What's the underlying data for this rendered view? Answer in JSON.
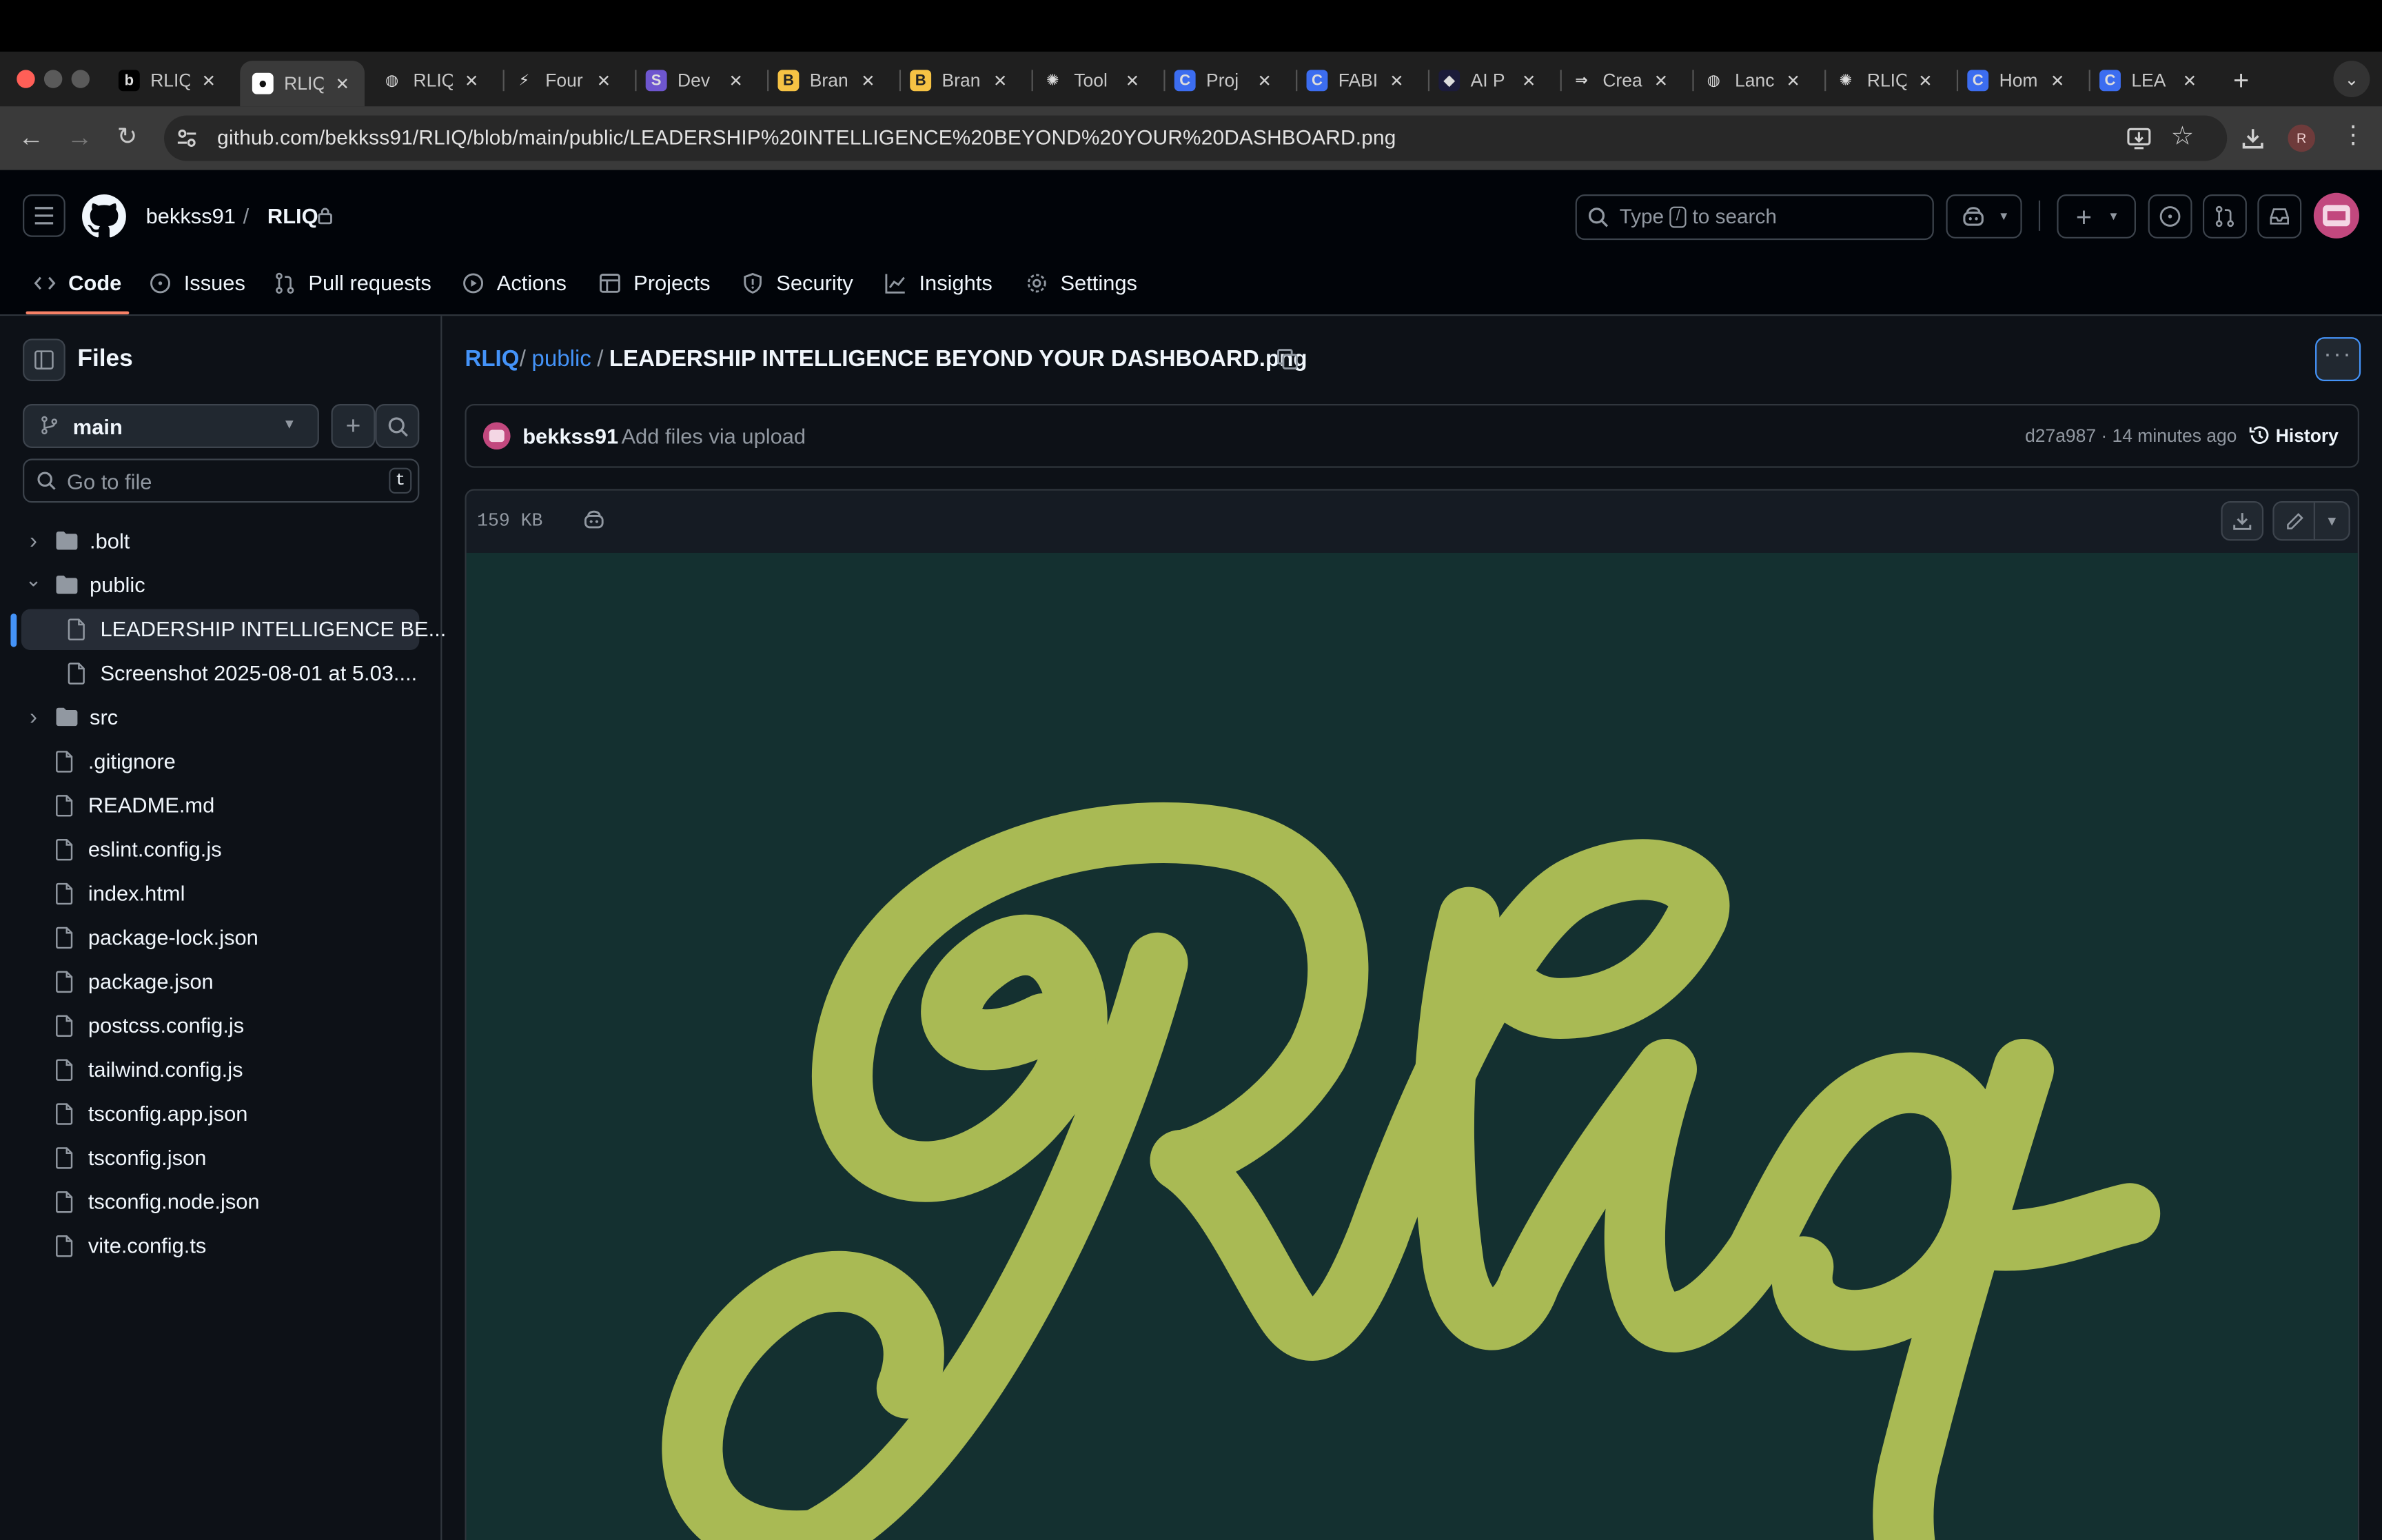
{
  "browser": {
    "tabs": [
      {
        "label": "RLIQ",
        "icon": "bolt-b-icon",
        "active": false
      },
      {
        "label": "RLIQ",
        "icon": "github-icon",
        "active": true
      },
      {
        "label": "RLIQ",
        "icon": "globe-icon",
        "active": false
      },
      {
        "label": "Four",
        "icon": "lightning-icon",
        "active": false
      },
      {
        "label": "Dev",
        "icon": "s-icon",
        "active": false
      },
      {
        "label": "Bran",
        "icon": "b-icon",
        "active": false
      },
      {
        "label": "Bran",
        "icon": "b-icon",
        "active": false
      },
      {
        "label": "Tool",
        "icon": "openai-icon",
        "active": false
      },
      {
        "label": "Proj",
        "icon": "c-icon",
        "active": false
      },
      {
        "label": "FABI",
        "icon": "c-icon",
        "active": false
      },
      {
        "label": "AI P",
        "icon": "ai-icon",
        "active": false
      },
      {
        "label": "Crea",
        "icon": "arrow-icon",
        "active": false
      },
      {
        "label": "Lanc",
        "icon": "globe-icon",
        "active": false
      },
      {
        "label": "RLIQ",
        "icon": "openai-icon",
        "active": false
      },
      {
        "label": "Hom",
        "icon": "c-icon",
        "active": false
      },
      {
        "label": "LEA",
        "icon": "c-icon",
        "active": false
      }
    ],
    "url": "github.com/bekkss91/RLIQ/blob/main/public/LEADERSHIP%20INTELLIGENCE%20BEYOND%20YOUR%20DASHBOARD.png",
    "profile_initial": "R"
  },
  "header": {
    "owner": "bekkss91",
    "separator": "/",
    "repo": "RLIQ",
    "search": {
      "prefix": "Type",
      "key": "/",
      "suffix": "to search"
    }
  },
  "repo_nav": {
    "tabs": [
      {
        "label": "Code",
        "icon": "code-icon",
        "active": true
      },
      {
        "label": "Issues",
        "icon": "issue-icon"
      },
      {
        "label": "Pull requests",
        "icon": "pull-request-icon"
      },
      {
        "label": "Actions",
        "icon": "play-icon"
      },
      {
        "label": "Projects",
        "icon": "table-icon"
      },
      {
        "label": "Security",
        "icon": "shield-icon"
      },
      {
        "label": "Insights",
        "icon": "graph-icon"
      },
      {
        "label": "Settings",
        "icon": "gear-icon"
      }
    ]
  },
  "sidebar": {
    "title": "Files",
    "branch": "main",
    "goto_placeholder": "Go to file",
    "goto_key": "t",
    "tree": [
      {
        "name": ".bolt",
        "type": "folder",
        "expanded": false,
        "depth": 0
      },
      {
        "name": "public",
        "type": "folder",
        "expanded": true,
        "depth": 0
      },
      {
        "name": "LEADERSHIP INTELLIGENCE BE...",
        "type": "file",
        "depth": 1,
        "selected": true
      },
      {
        "name": "Screenshot 2025-08-01 at 5.03....",
        "type": "file",
        "depth": 1
      },
      {
        "name": "src",
        "type": "folder",
        "expanded": false,
        "depth": 0
      },
      {
        "name": ".gitignore",
        "type": "file",
        "depth": 0
      },
      {
        "name": "README.md",
        "type": "file",
        "depth": 0
      },
      {
        "name": "eslint.config.js",
        "type": "file",
        "depth": 0
      },
      {
        "name": "index.html",
        "type": "file",
        "depth": 0
      },
      {
        "name": "package-lock.json",
        "type": "file",
        "depth": 0
      },
      {
        "name": "package.json",
        "type": "file",
        "depth": 0
      },
      {
        "name": "postcss.config.js",
        "type": "file",
        "depth": 0
      },
      {
        "name": "tailwind.config.js",
        "type": "file",
        "depth": 0
      },
      {
        "name": "tsconfig.app.json",
        "type": "file",
        "depth": 0
      },
      {
        "name": "tsconfig.json",
        "type": "file",
        "depth": 0
      },
      {
        "name": "tsconfig.node.json",
        "type": "file",
        "depth": 0
      },
      {
        "name": "vite.config.ts",
        "type": "file",
        "depth": 0
      }
    ]
  },
  "breadcrumb": {
    "repo": "RLIQ",
    "folder": "public",
    "sep": "/",
    "file": "LEADERSHIP INTELLIGENCE BEYOND YOUR DASHBOARD.png"
  },
  "commit": {
    "author": "bekkss91",
    "message": "Add files via upload",
    "sha_time": "d27a987 · 14 minutes ago",
    "history_label": "History"
  },
  "file": {
    "size": "159 KB",
    "image_bg": "#143030",
    "logo_color": "#a9ba54"
  },
  "colors": {
    "accent": "#4493f8",
    "active_tab_underline": "#f78166",
    "bg": "#0d1117"
  }
}
